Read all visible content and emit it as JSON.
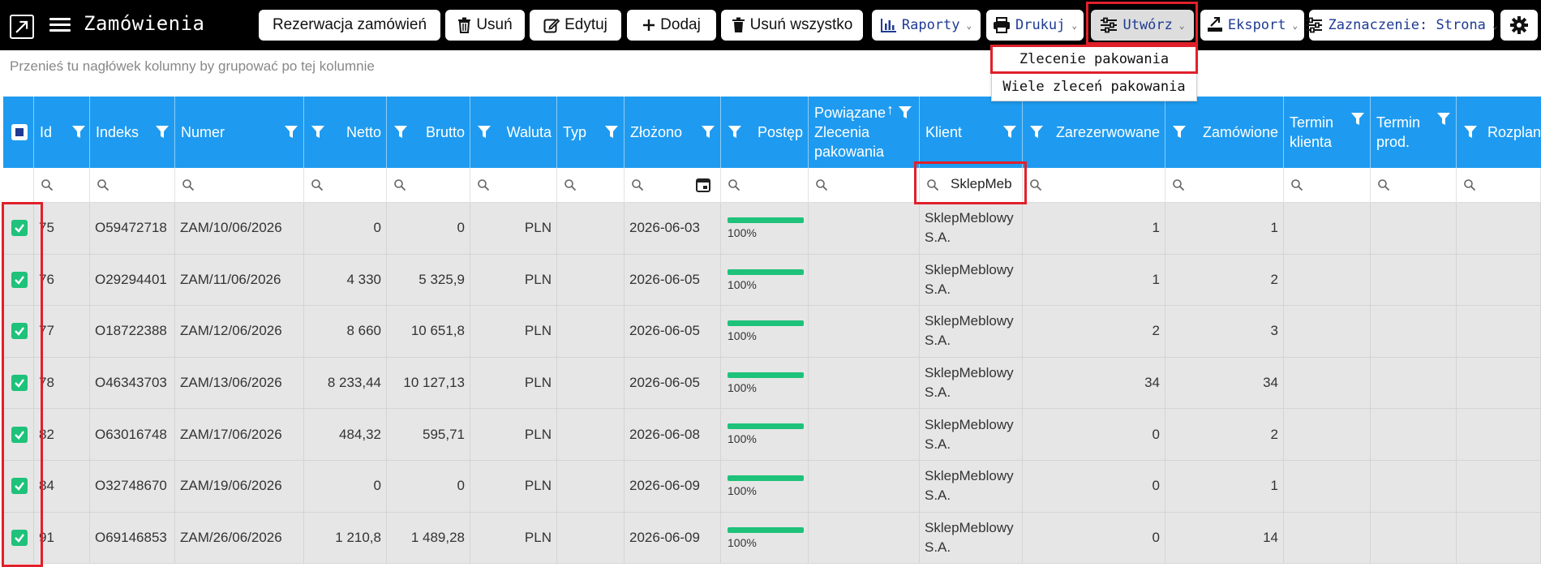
{
  "app": {
    "title": "Zamówienia"
  },
  "toolbar": {
    "reservation_label": "Rezerwacja zamówień",
    "delete_label": "Usuń",
    "edit_label": "Edytuj",
    "add_label": "Dodaj",
    "delete_all_label": "Usuń wszystko",
    "reports_label": "Raporty",
    "print_label": "Drukuj",
    "create_label": "Utwórz",
    "export_label": "Eksport",
    "selection_label": "Zaznaczenie: Strona"
  },
  "create_menu": {
    "items": [
      "Zlecenie pakowania",
      "Wiele zleceń pakowania"
    ]
  },
  "group_hint": "Przenieś tu nagłówek kolumny by grupować po tej kolumnie",
  "grid": {
    "columns": {
      "id": "Id",
      "indeks": "Indeks",
      "numer": "Numer",
      "netto": "Netto",
      "brutto": "Brutto",
      "waluta": "Waluta",
      "typ": "Typ",
      "zlozono": "Złożono",
      "postep": "Postęp",
      "powiazane_1": "Powiązane",
      "powiazane_2": "Zlecenia",
      "powiazane_3": "pakowania",
      "klient": "Klient",
      "zarezerwowane": "Zarezerwowane",
      "zamowione": "Zamówione",
      "termin_klienta_1": "Termin",
      "termin_klienta_2": "klienta",
      "termin_prod_1": "Termin",
      "termin_prod_2": "prod.",
      "rozplan": "Rozplan"
    },
    "filters": {
      "klient": "SklepMeb"
    },
    "rows": [
      {
        "id": "75",
        "indeks": "O59472718",
        "numer": "ZAM/10/06/2026",
        "netto": "0",
        "brutto": "0",
        "waluta": "PLN",
        "zlozono": "2026-06-03",
        "progress": 100,
        "progress_label": "100%",
        "klient_1": "SklepMeblowy",
        "klient_2": "S.A.",
        "zarezerwowane": "1",
        "zamowione": "1"
      },
      {
        "id": "76",
        "indeks": "O29294401",
        "numer": "ZAM/11/06/2026",
        "netto": "4 330",
        "brutto": "5 325,9",
        "waluta": "PLN",
        "zlozono": "2026-06-05",
        "progress": 100,
        "progress_label": "100%",
        "klient_1": "SklepMeblowy",
        "klient_2": "S.A.",
        "zarezerwowane": "1",
        "zamowione": "2"
      },
      {
        "id": "77",
        "indeks": "O18722388",
        "numer": "ZAM/12/06/2026",
        "netto": "8 660",
        "brutto": "10 651,8",
        "waluta": "PLN",
        "zlozono": "2026-06-05",
        "progress": 100,
        "progress_label": "100%",
        "klient_1": "SklepMeblowy",
        "klient_2": "S.A.",
        "zarezerwowane": "2",
        "zamowione": "3"
      },
      {
        "id": "78",
        "indeks": "O46343703",
        "numer": "ZAM/13/06/2026",
        "netto": "8 233,44",
        "brutto": "10 127,13",
        "waluta": "PLN",
        "zlozono": "2026-06-05",
        "progress": 100,
        "progress_label": "100%",
        "klient_1": "SklepMeblowy",
        "klient_2": "S.A.",
        "zarezerwowane": "34",
        "zamowione": "34"
      },
      {
        "id": "82",
        "indeks": "O63016748",
        "numer": "ZAM/17/06/2026",
        "netto": "484,32",
        "brutto": "595,71",
        "waluta": "PLN",
        "zlozono": "2026-06-08",
        "progress": 100,
        "progress_label": "100%",
        "klient_1": "SklepMeblowy",
        "klient_2": "S.A.",
        "zarezerwowane": "0",
        "zamowione": "2"
      },
      {
        "id": "84",
        "indeks": "O32748670",
        "numer": "ZAM/19/06/2026",
        "netto": "0",
        "brutto": "0",
        "waluta": "PLN",
        "zlozono": "2026-06-09",
        "progress": 100,
        "progress_label": "100%",
        "klient_1": "SklepMeblowy",
        "klient_2": "S.A.",
        "zarezerwowane": "0",
        "zamowione": "1"
      },
      {
        "id": "91",
        "indeks": "O69146853",
        "numer": "ZAM/26/06/2026",
        "netto": "1 210,8",
        "brutto": "1 489,28",
        "waluta": "PLN",
        "zlozono": "2026-06-09",
        "progress": 100,
        "progress_label": "100%",
        "klient_1": "SklepMeblowy",
        "klient_2": "S.A.",
        "zarezerwowane": "0",
        "zamowione": "14"
      }
    ]
  },
  "colors": {
    "header_bg": "#1e9bf0",
    "check_green": "#1ec27a",
    "highlight_red": "#e0202a",
    "accent_blue": "#1f3a93"
  }
}
